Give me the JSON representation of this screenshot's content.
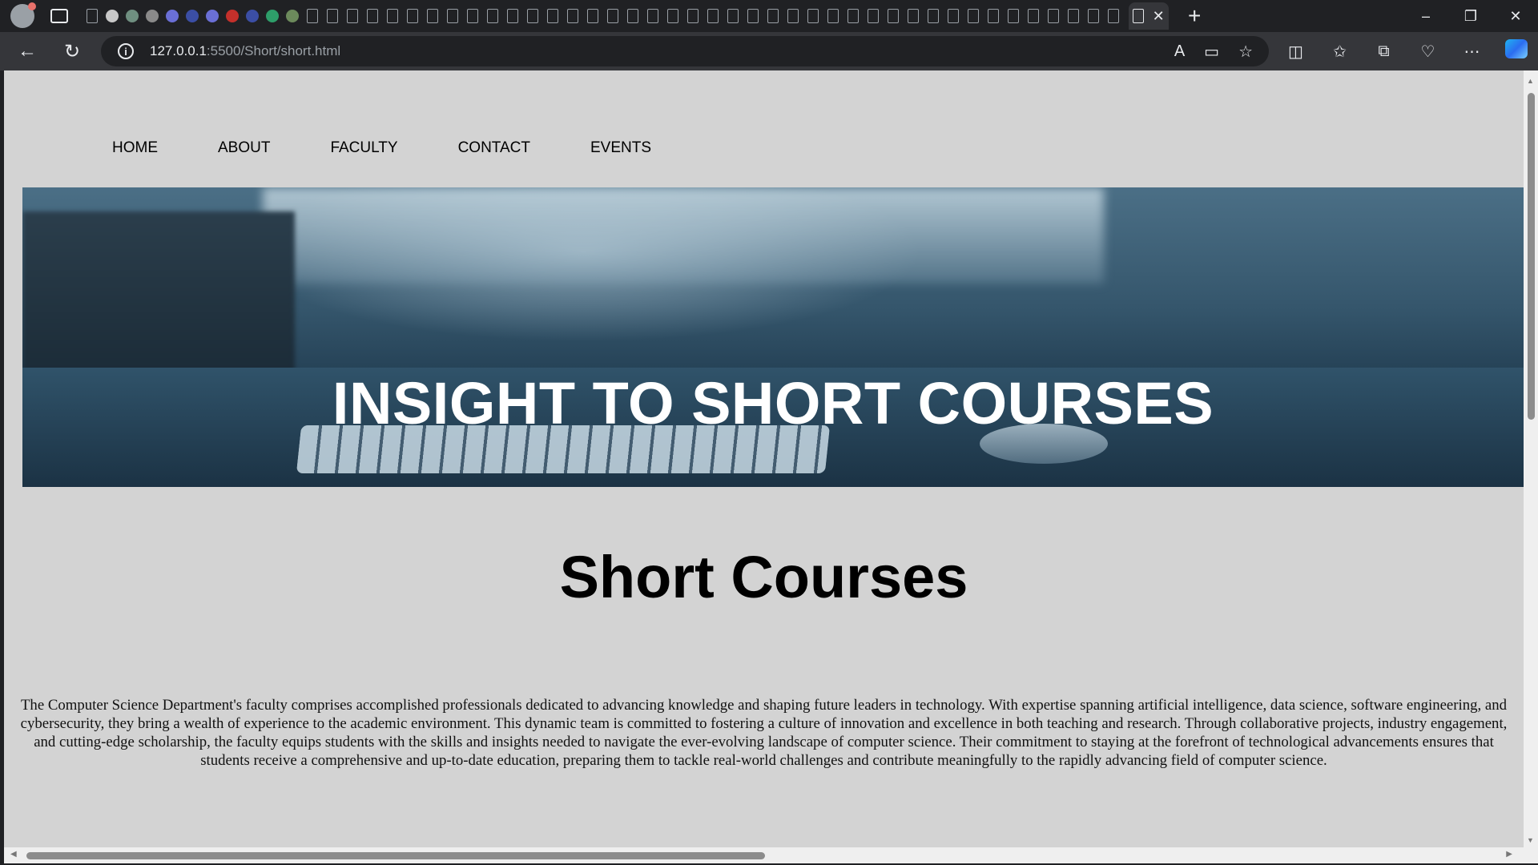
{
  "browser": {
    "url_host": "127.0.0.1",
    "url_path": ":5500/Short/short.html",
    "window_controls": [
      "–",
      "❐",
      "✕"
    ]
  },
  "nav": {
    "items": [
      "HOME",
      "ABOUT",
      "FACULTY",
      "CONTACT",
      "EVENTS"
    ]
  },
  "hero": {
    "title": "INSIGHT TO SHORT COURSES"
  },
  "main": {
    "heading": "Short Courses",
    "paragraph": "The Computer Science Department's faculty comprises accomplished professionals dedicated to advancing knowledge and shaping future leaders in technology. With expertise spanning artificial intelligence, data science, software engineering, and cybersecurity, they bring a wealth of experience to the academic environment. This dynamic team is committed to fostering a culture of innovation and excellence in both teaching and research. Through collaborative projects, industry engagement, and cutting-edge scholarship, the faculty equips students with the skills and insights needed to navigate the ever-evolving landscape of computer science. Their commitment to staying at the forefront of technological advancements ensures that students receive a comprehensive and up-to-date education, preparing them to tackle real-world challenges and contribute meaningfully to the rapidly advancing field of computer science."
  },
  "colors": {
    "page_background": "#d3d3d3",
    "hero_text": "#ffffff",
    "chrome_dark": "#202124"
  }
}
